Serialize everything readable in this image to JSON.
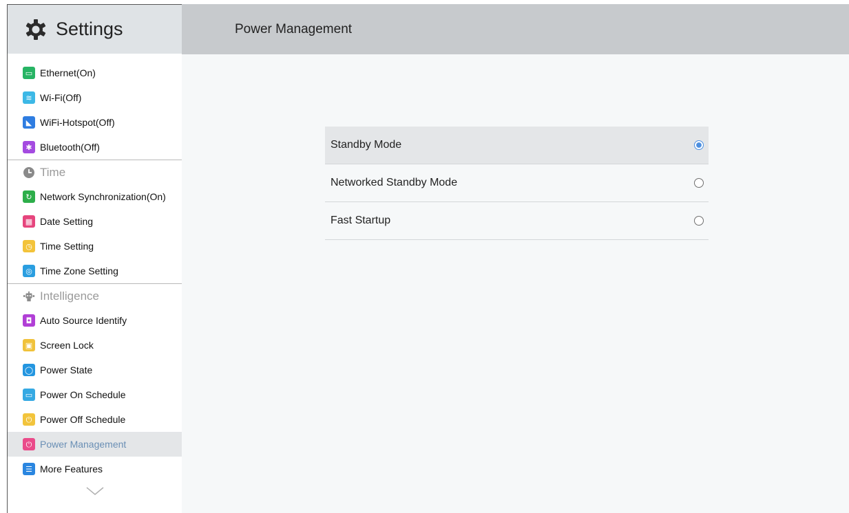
{
  "sidebar": {
    "title": "Settings",
    "items": [
      {
        "label": "Ethernet(On)",
        "icon": "ethernet-icon",
        "color": "#27b464",
        "glyph": "▭"
      },
      {
        "label": "Wi-Fi(Off)",
        "icon": "wifi-icon",
        "color": "#3cb8e6",
        "glyph": "≋"
      },
      {
        "label": "WiFi-Hotspot(Off)",
        "icon": "hotspot-icon",
        "color": "#2f7de1",
        "glyph": "◣"
      },
      {
        "label": "Bluetooth(Off)",
        "icon": "bluetooth-icon",
        "color": "#a44be0",
        "glyph": "✱"
      },
      {
        "label": "Network Synchronization(On)",
        "icon": "sync-icon",
        "color": "#2dae4a",
        "glyph": "↻"
      },
      {
        "label": "Date Setting",
        "icon": "calendar-icon",
        "color": "#e6457d",
        "glyph": "▦"
      },
      {
        "label": "Time Setting",
        "icon": "clock-icon",
        "color": "#f3c33a",
        "glyph": "◷"
      },
      {
        "label": "Time Zone Setting",
        "icon": "timezone-icon",
        "color": "#2a9ee0",
        "glyph": "◎"
      },
      {
        "label": "Auto Source Identify",
        "icon": "source-identify-icon",
        "color": "#b13fd6",
        "glyph": "◘"
      },
      {
        "label": "Screen Lock",
        "icon": "lock-icon",
        "color": "#f0c23b",
        "glyph": "▣"
      },
      {
        "label": "Power State",
        "icon": "power-state-icon",
        "color": "#2496e0",
        "glyph": "◯"
      },
      {
        "label": "Power On Schedule",
        "icon": "power-on-schedule-icon",
        "color": "#35a9e3",
        "glyph": "▭"
      },
      {
        "label": "Power Off Schedule",
        "icon": "power-off-schedule-icon",
        "color": "#f2c43c",
        "glyph": "⏻"
      },
      {
        "label": "Power Management",
        "icon": "power-management-icon",
        "color": "#ea4b8a",
        "glyph": "⏻"
      },
      {
        "label": "More Features",
        "icon": "more-features-icon",
        "color": "#2a86e0",
        "glyph": "☰"
      }
    ],
    "sections": {
      "time": "Time",
      "intelligence": "Intelligence"
    }
  },
  "main": {
    "title": "Power Management",
    "options": [
      {
        "label": "Standby Mode",
        "selected": true
      },
      {
        "label": "Networked Standby Mode",
        "selected": false
      },
      {
        "label": "Fast Startup",
        "selected": false
      }
    ]
  },
  "colors": {
    "accent": "#4c8fe0",
    "selected_text": "#6a8fb5"
  }
}
